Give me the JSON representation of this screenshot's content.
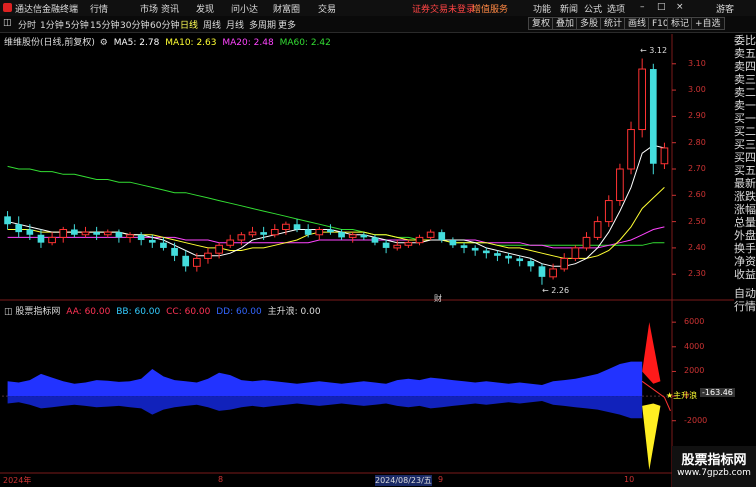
{
  "app": {
    "title": "通达信金融终端",
    "menus": [
      "行情",
      "市场",
      "资讯",
      "发现",
      "问小达",
      "财富圈",
      "交易"
    ],
    "banner": "证券交易未登录",
    "banner2": "增值服务",
    "right_menus": [
      "功能",
      "新闻",
      "公式",
      "选项"
    ],
    "user": "游客",
    "window_controls": [
      "–",
      "□",
      "×"
    ]
  },
  "toolbar": {
    "left_icon": "◫",
    "timeframes": [
      "分时",
      "1分钟",
      "5分钟",
      "15分钟",
      "30分钟",
      "60分钟",
      "日线",
      "周线",
      "月线",
      "多周期",
      "更多"
    ],
    "active": "日线",
    "right_buttons": [
      "复权",
      "叠加",
      "多股",
      "统计",
      "画线",
      "F10",
      "标记",
      "+自选"
    ]
  },
  "main_chart": {
    "title": "维维股份(日线,前复权)",
    "ma_labels": [
      {
        "text": "MA5: 2.78",
        "color": "#ffffff"
      },
      {
        "text": "MA10: 2.63",
        "color": "#ffff33"
      },
      {
        "text": "MA20: 2.48",
        "color": "#ff44ff"
      },
      {
        "text": "MA60: 2.42",
        "color": "#33dd33"
      }
    ],
    "price_ticks": [
      "3.10",
      "3.00",
      "2.90",
      "2.80",
      "2.70",
      "2.60",
      "2.50",
      "2.40",
      "2.30"
    ],
    "high_label": "3.12",
    "low_label": "2.26",
    "cai_label": "财"
  },
  "indicator": {
    "title": "股票指标网",
    "labels": [
      {
        "text": "AA: 60.00",
        "color": "#ff3355"
      },
      {
        "text": "BB: 60.00",
        "color": "#33ccff"
      },
      {
        "text": "CC: 60.00",
        "color": "#ff3355"
      },
      {
        "text": "DD: 60.00",
        "color": "#3366ff"
      },
      {
        "text": "主升浪: 0.00",
        "color": "#dddddd"
      }
    ],
    "y_ticks": [
      "6000",
      "4000",
      "2000",
      "0",
      "-2000"
    ],
    "value_box": "-163.46",
    "annotation": "主升浪"
  },
  "x_axis": {
    "labels": [
      "2024年",
      "8",
      "2024/08/23/五",
      "9",
      "10"
    ]
  },
  "right_panel": {
    "items": [
      "委比",
      "卖五",
      "卖四",
      "卖三",
      "卖二",
      "卖一",
      "买一",
      "买二",
      "买三",
      "买四",
      "买五",
      "最新",
      "涨跌",
      "涨幅",
      "总量",
      "外盘",
      "换手",
      "净资",
      "收益",
      "自动",
      "行情"
    ]
  },
  "watermark": {
    "line1": "股票指标网",
    "line2": "www.7gpzb.com"
  },
  "chart_data": {
    "type": "candlestick",
    "candles": [
      [
        2.52,
        2.49,
        2.54,
        2.47
      ],
      [
        2.49,
        2.46,
        2.52,
        2.44
      ],
      [
        2.47,
        2.45,
        2.49,
        2.43
      ],
      [
        2.45,
        2.42,
        2.47,
        2.4
      ],
      [
        2.42,
        2.44,
        2.46,
        2.41
      ],
      [
        2.44,
        2.47,
        2.48,
        2.42
      ],
      [
        2.47,
        2.45,
        2.49,
        2.44
      ],
      [
        2.45,
        2.46,
        2.48,
        2.44
      ],
      [
        2.46,
        2.45,
        2.48,
        2.43
      ],
      [
        2.45,
        2.46,
        2.47,
        2.44
      ],
      [
        2.46,
        2.44,
        2.47,
        2.42
      ],
      [
        2.44,
        2.45,
        2.46,
        2.42
      ],
      [
        2.45,
        2.43,
        2.46,
        2.41
      ],
      [
        2.43,
        2.42,
        2.45,
        2.4
      ],
      [
        2.42,
        2.4,
        2.44,
        2.39
      ],
      [
        2.4,
        2.37,
        2.42,
        2.35
      ],
      [
        2.37,
        2.33,
        2.39,
        2.31
      ],
      [
        2.33,
        2.36,
        2.38,
        2.31
      ],
      [
        2.36,
        2.38,
        2.4,
        2.34
      ],
      [
        2.38,
        2.41,
        2.42,
        2.36
      ],
      [
        2.41,
        2.43,
        2.45,
        2.4
      ],
      [
        2.43,
        2.45,
        2.46,
        2.41
      ],
      [
        2.45,
        2.46,
        2.48,
        2.44
      ],
      [
        2.46,
        2.45,
        2.48,
        2.43
      ],
      [
        2.45,
        2.47,
        2.49,
        2.44
      ],
      [
        2.47,
        2.49,
        2.5,
        2.45
      ],
      [
        2.49,
        2.47,
        2.51,
        2.46
      ],
      [
        2.47,
        2.45,
        2.49,
        2.44
      ],
      [
        2.45,
        2.47,
        2.48,
        2.43
      ],
      [
        2.47,
        2.46,
        2.49,
        2.45
      ],
      [
        2.46,
        2.44,
        2.47,
        2.43
      ],
      [
        2.44,
        2.45,
        2.46,
        2.42
      ],
      [
        2.45,
        2.44,
        2.46,
        2.43
      ],
      [
        2.44,
        2.42,
        2.45,
        2.41
      ],
      [
        2.42,
        2.4,
        2.43,
        2.38
      ],
      [
        2.4,
        2.41,
        2.43,
        2.39
      ],
      [
        2.41,
        2.42,
        2.43,
        2.4
      ],
      [
        2.42,
        2.44,
        2.45,
        2.41
      ],
      [
        2.44,
        2.46,
        2.47,
        2.43
      ],
      [
        2.46,
        2.43,
        2.47,
        2.42
      ],
      [
        2.43,
        2.41,
        2.44,
        2.4
      ],
      [
        2.41,
        2.4,
        2.42,
        2.38
      ],
      [
        2.4,
        2.39,
        2.41,
        2.37
      ],
      [
        2.39,
        2.38,
        2.4,
        2.36
      ],
      [
        2.38,
        2.37,
        2.39,
        2.35
      ],
      [
        2.37,
        2.36,
        2.38,
        2.34
      ],
      [
        2.36,
        2.35,
        2.37,
        2.33
      ],
      [
        2.35,
        2.33,
        2.36,
        2.31
      ],
      [
        2.33,
        2.29,
        2.34,
        2.26
      ],
      [
        2.29,
        2.32,
        2.34,
        2.28
      ],
      [
        2.32,
        2.36,
        2.38,
        2.31
      ],
      [
        2.36,
        2.4,
        2.41,
        2.35
      ],
      [
        2.4,
        2.44,
        2.46,
        2.39
      ],
      [
        2.44,
        2.5,
        2.52,
        2.43
      ],
      [
        2.5,
        2.58,
        2.6,
        2.48
      ],
      [
        2.58,
        2.7,
        2.72,
        2.56
      ],
      [
        2.7,
        2.85,
        2.88,
        2.68
      ],
      [
        2.85,
        3.08,
        3.12,
        2.82
      ],
      [
        3.08,
        2.72,
        3.1,
        2.68
      ],
      [
        2.72,
        2.78,
        2.8,
        2.7
      ]
    ],
    "ma5": [
      2.5,
      2.49,
      2.48,
      2.47,
      2.46,
      2.46,
      2.46,
      2.46,
      2.46,
      2.46,
      2.46,
      2.45,
      2.45,
      2.44,
      2.43,
      2.41,
      2.39,
      2.37,
      2.37,
      2.37,
      2.38,
      2.4,
      2.43,
      2.44,
      2.45,
      2.46,
      2.47,
      2.47,
      2.47,
      2.47,
      2.46,
      2.45,
      2.45,
      2.44,
      2.43,
      2.42,
      2.42,
      2.42,
      2.43,
      2.43,
      2.43,
      2.43,
      2.42,
      2.4,
      2.39,
      2.38,
      2.37,
      2.36,
      2.34,
      2.33,
      2.33,
      2.34,
      2.36,
      2.4,
      2.46,
      2.54,
      2.63,
      2.76,
      2.79,
      2.78
    ],
    "ma10": [
      2.47,
      2.47,
      2.47,
      2.46,
      2.46,
      2.46,
      2.46,
      2.46,
      2.46,
      2.46,
      2.46,
      2.45,
      2.45,
      2.45,
      2.44,
      2.43,
      2.42,
      2.41,
      2.4,
      2.4,
      2.39,
      2.39,
      2.4,
      2.4,
      2.41,
      2.42,
      2.43,
      2.45,
      2.46,
      2.46,
      2.46,
      2.46,
      2.46,
      2.45,
      2.45,
      2.44,
      2.43,
      2.43,
      2.43,
      2.43,
      2.42,
      2.42,
      2.42,
      2.42,
      2.41,
      2.4,
      2.4,
      2.39,
      2.38,
      2.37,
      2.36,
      2.36,
      2.36,
      2.37,
      2.39,
      2.43,
      2.48,
      2.55,
      2.59,
      2.63
    ],
    "ma20": [
      2.44,
      2.44,
      2.44,
      2.44,
      2.44,
      2.44,
      2.44,
      2.44,
      2.44,
      2.44,
      2.44,
      2.44,
      2.44,
      2.44,
      2.44,
      2.44,
      2.43,
      2.43,
      2.43,
      2.42,
      2.42,
      2.42,
      2.42,
      2.42,
      2.42,
      2.42,
      2.42,
      2.42,
      2.43,
      2.43,
      2.43,
      2.43,
      2.43,
      2.43,
      2.43,
      2.43,
      2.43,
      2.43,
      2.43,
      2.43,
      2.43,
      2.43,
      2.43,
      2.42,
      2.42,
      2.42,
      2.42,
      2.41,
      2.41,
      2.4,
      2.4,
      2.4,
      2.4,
      2.4,
      2.41,
      2.42,
      2.43,
      2.45,
      2.47,
      2.48
    ],
    "ma60": [
      2.71,
      2.7,
      2.7,
      2.69,
      2.69,
      2.68,
      2.68,
      2.67,
      2.66,
      2.66,
      2.65,
      2.65,
      2.64,
      2.63,
      2.62,
      2.61,
      2.61,
      2.6,
      2.59,
      2.58,
      2.57,
      2.56,
      2.55,
      2.54,
      2.53,
      2.52,
      2.51,
      2.5,
      2.49,
      2.48,
      2.47,
      2.47,
      2.46,
      2.45,
      2.45,
      2.44,
      2.44,
      2.43,
      2.43,
      2.43,
      2.42,
      2.42,
      2.42,
      2.42,
      2.41,
      2.41,
      2.41,
      2.41,
      2.41,
      2.41,
      2.41,
      2.41,
      2.41,
      2.41,
      2.41,
      2.41,
      2.41,
      2.41,
      2.42,
      2.42
    ],
    "ylim": [
      2.24,
      3.16
    ],
    "indicator_upper": [
      1200,
      1100,
      1300,
      1800,
      1500,
      1200,
      1000,
      1100,
      1300,
      1250,
      1150,
      1200,
      1400,
      2200,
      1600,
      1300,
      1200,
      1100,
      1400,
      1900,
      1700,
      1300,
      1200,
      1300,
      1200,
      1100,
      1000,
      1100,
      1200,
      1100,
      1000,
      1100,
      1200,
      1100,
      1000,
      1300,
      1400,
      1300,
      1500,
      1400,
      1300,
      1200,
      1100,
      1200,
      1100,
      1000,
      1100,
      1000,
      900,
      1200,
      1300,
      1400,
      1600,
      1800,
      2200,
      2600,
      3000,
      6000,
      1000,
      0
    ],
    "indicator_lower": [
      -600,
      -500,
      -700,
      -1000,
      -900,
      -800,
      -700,
      -800,
      -900,
      -850,
      -800,
      -900,
      -1000,
      -1500,
      -1100,
      -900,
      -800,
      -700,
      -900,
      -1200,
      -1100,
      -900,
      -800,
      -900,
      -800,
      -700,
      -600,
      -700,
      -800,
      -700,
      -600,
      -700,
      -800,
      -700,
      -600,
      -800,
      -900,
      -800,
      -1000,
      -900,
      -800,
      -700,
      -600,
      -700,
      -600,
      -500,
      -600,
      -500,
      -400,
      -700,
      -800,
      -900,
      -1000,
      -1100,
      -1300,
      -1500,
      -1800,
      -6000,
      -1000,
      0
    ],
    "indicator_ylim": [
      -6000,
      6500
    ]
  }
}
